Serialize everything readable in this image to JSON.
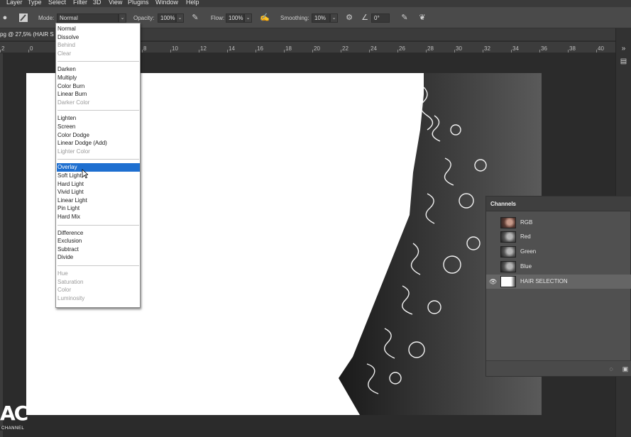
{
  "menubar": {
    "items": [
      "Layer",
      "Type",
      "Select",
      "Filter",
      "3D",
      "View",
      "Plugins",
      "Window",
      "Help"
    ]
  },
  "options": {
    "mode_label": "Mode:",
    "mode_value": "Normal",
    "opacity_label": "Opacity:",
    "opacity_value": "100%",
    "flow_label": "Flow:",
    "flow_value": "100%",
    "smoothing_label": "Smoothing:",
    "smoothing_value": "10%",
    "angle_value": "0°",
    "icons": [
      "brush-tool-icon",
      "brush-preset-icon",
      "pressure-opacity-icon",
      "airbrush-icon",
      "smoothing-settings-gear-icon",
      "angle-icon",
      "pressure-size-icon",
      "symmetry-butterfly-icon"
    ]
  },
  "document": {
    "tab_title": "pg @ 27,5% (HAIR S"
  },
  "ruler": {
    "ticks": [
      "2",
      "0",
      "2",
      "4",
      "6",
      "8",
      "10",
      "12",
      "14",
      "16",
      "18",
      "20",
      "22",
      "24",
      "26",
      "28",
      "30",
      "32",
      "34",
      "36",
      "38",
      "40"
    ]
  },
  "blend_modes": {
    "groups": [
      [
        {
          "label": "Normal",
          "enabled": true
        },
        {
          "label": "Dissolve",
          "enabled": true
        },
        {
          "label": "Behind",
          "enabled": false
        },
        {
          "label": "Clear",
          "enabled": false
        }
      ],
      [
        {
          "label": "Darken",
          "enabled": true
        },
        {
          "label": "Multiply",
          "enabled": true
        },
        {
          "label": "Color Burn",
          "enabled": true
        },
        {
          "label": "Linear Burn",
          "enabled": true
        },
        {
          "label": "Darker Color",
          "enabled": false
        }
      ],
      [
        {
          "label": "Lighten",
          "enabled": true
        },
        {
          "label": "Screen",
          "enabled": true
        },
        {
          "label": "Color Dodge",
          "enabled": true
        },
        {
          "label": "Linear Dodge (Add)",
          "enabled": true
        },
        {
          "label": "Lighter Color",
          "enabled": false
        }
      ],
      [
        {
          "label": "Overlay",
          "enabled": true,
          "selected": true
        },
        {
          "label": "Soft Light",
          "enabled": true
        },
        {
          "label": "Hard Light",
          "enabled": true
        },
        {
          "label": "Vivid Light",
          "enabled": true
        },
        {
          "label": "Linear Light",
          "enabled": true
        },
        {
          "label": "Pin Light",
          "enabled": true
        },
        {
          "label": "Hard Mix",
          "enabled": true
        }
      ],
      [
        {
          "label": "Difference",
          "enabled": true
        },
        {
          "label": "Exclusion",
          "enabled": true
        },
        {
          "label": "Subtract",
          "enabled": true
        },
        {
          "label": "Divide",
          "enabled": true
        }
      ],
      [
        {
          "label": "Hue",
          "enabled": false
        },
        {
          "label": "Saturation",
          "enabled": false
        },
        {
          "label": "Color",
          "enabled": false
        },
        {
          "label": "Luminosity",
          "enabled": false
        }
      ]
    ]
  },
  "channels": {
    "title": "Channels",
    "rows": [
      {
        "name": "RGB",
        "visible": false,
        "thumb": "color-portrait"
      },
      {
        "name": "Red",
        "visible": false,
        "thumb": "gray-portrait"
      },
      {
        "name": "Green",
        "visible": false,
        "thumb": "gray-portrait"
      },
      {
        "name": "Blue",
        "visible": false,
        "thumb": "gray-portrait"
      },
      {
        "name": "HAIR SELECTION",
        "visible": true,
        "active": true,
        "thumb": "mask"
      }
    ]
  },
  "watermark": {
    "big": "AC",
    "small": "CHANNEL"
  },
  "colors": {
    "selection": "#1e6fd0",
    "panel_bg": "#505050",
    "ui_dark": "#2b2b2b"
  }
}
